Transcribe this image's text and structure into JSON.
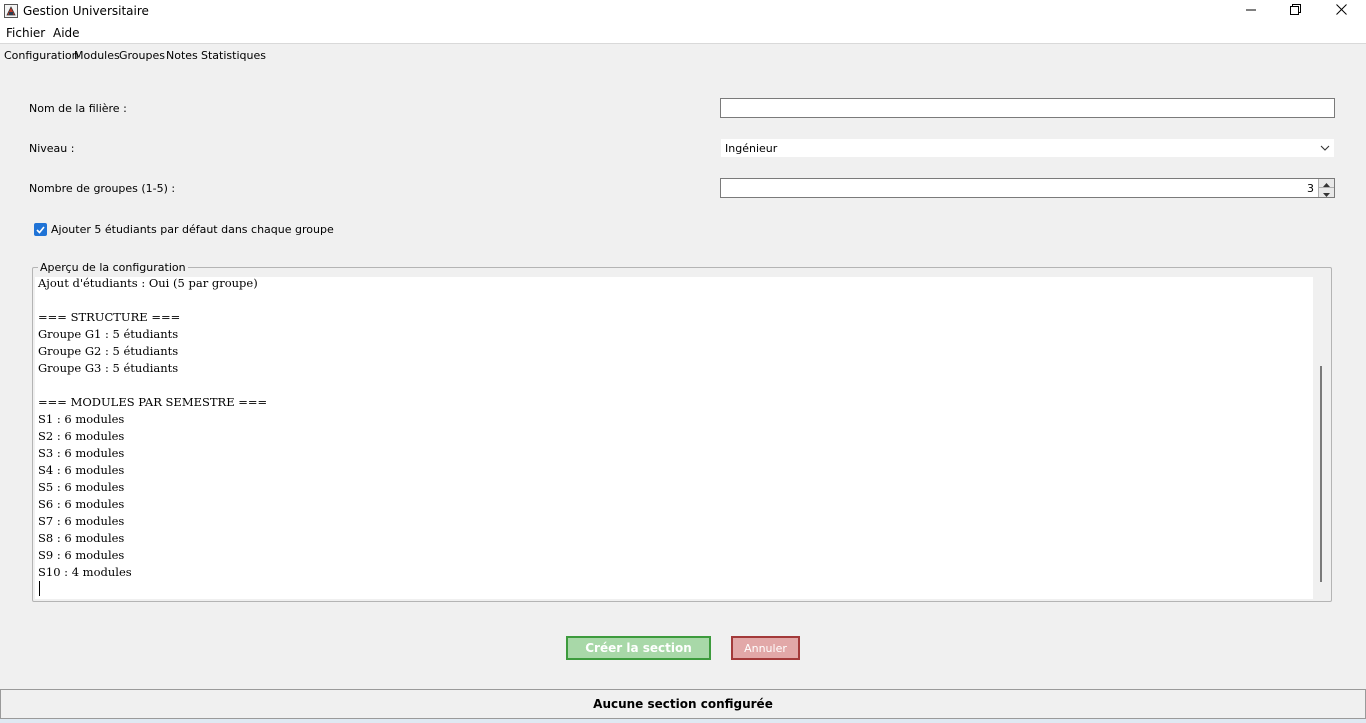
{
  "window": {
    "title": "Gestion Universitaire",
    "minimize": "—",
    "maximize": "❐",
    "close": "✕"
  },
  "menu": [
    "Fichier",
    "Aide"
  ],
  "tabs": [
    "Configuration",
    "Modules",
    "Groupes",
    "Notes",
    "Statistiques"
  ],
  "form": {
    "filiere_label": "Nom de la filière :",
    "filiere_value": "",
    "niveau_label": "Niveau :",
    "niveau_value": "Ingénieur",
    "groupes_label": "Nombre de groupes (1-5) :",
    "groupes_value": "3",
    "checkbox_label": "Ajouter 5 étudiants par défaut dans chaque groupe",
    "checkbox_checked": true
  },
  "preview": {
    "title": "Aperçu de la configuration",
    "lines": [
      "Ajout d'étudiants : Oui (5 par groupe)",
      "",
      "=== STRUCTURE ===",
      "Groupe G1 : 5 étudiants",
      "Groupe G2 : 5 étudiants",
      "Groupe G3 : 5 étudiants",
      "",
      "=== MODULES PAR SEMESTRE ===",
      "S1 : 6 modules",
      "S2 : 6 modules",
      "S3 : 6 modules",
      "S4 : 6 modules",
      "S5 : 6 modules",
      "S6 : 6 modules",
      "S7 : 6 modules",
      "S8 : 6 modules",
      "S9 : 6 modules",
      "S10 : 4 modules"
    ]
  },
  "buttons": {
    "create": "Créer la section",
    "cancel": "Annuler"
  },
  "status": "Aucune section configurée",
  "colors": {
    "create_bg": "#a8d8a8",
    "create_border": "#3d9b3d",
    "cancel_bg": "#e2a8a8",
    "cancel_border": "#a33a3a",
    "checkbox": "#1f73d6"
  }
}
